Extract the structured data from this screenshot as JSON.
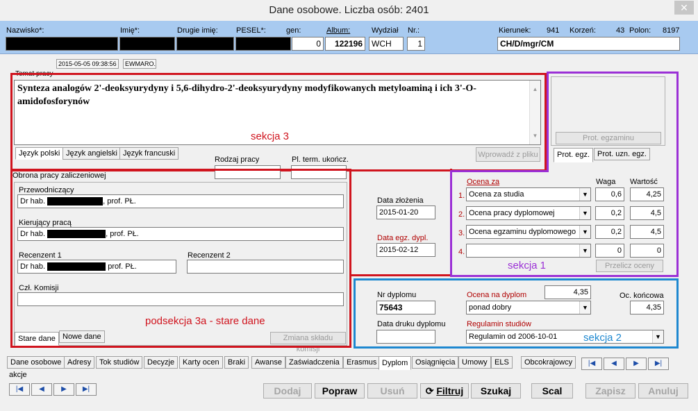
{
  "window": {
    "title": "Dane osobowe. Liczba osób: 2401",
    "close": "✕"
  },
  "header": {
    "labels": {
      "nazwisko": "Nazwisko*:",
      "imie": "Imię*:",
      "drugie_imie": "Drugie imię:",
      "pesel": "PESEL*:",
      "gen": "gen:",
      "album": "Album:",
      "wydzial": "Wydział",
      "nr": "Nr.:",
      "kierunek": "Kierunek:",
      "korzen": "Korzeń:",
      "polon": "Polon:"
    },
    "values": {
      "gen": "0",
      "album": "122196",
      "wydzial": "WCH",
      "nr": "1",
      "kierunek": "941",
      "korzen": "43",
      "polon": "8197",
      "path": "CH/D/mgr/CM"
    }
  },
  "meta": {
    "timestamp": "2015-05-05 09:38:56",
    "user": "EWMARO."
  },
  "thesis": {
    "label": "Temat pracy",
    "title": "Synteza analogów 2'-deoksyurydyny i 5,6-dihydro-2'-deoksyurydyny modyfikowanych metyloaminą i ich 3'-O-amidofosforynów",
    "tabs": [
      "Język polski",
      "Język angielski",
      "Język francuski"
    ],
    "import_button": "Wprowadź z pliku",
    "rodzaj_pracy": "Rodzaj pracy",
    "pl_term": "Pl. term. ukończ."
  },
  "defense": {
    "label": "Obrona pracy zaliczeniowej",
    "przewodniczacy_label": "Przewodniczący",
    "przewodniczacy_prefix": "Dr hab.",
    "przewodniczacy_suffix": ", prof. PŁ.",
    "kierujacy_label": "Kierujący pracą",
    "kierujacy_prefix": "Dr hab.",
    "kierujacy_suffix": ", prof. PŁ.",
    "recenzent1_label": "Recenzent 1",
    "recenzent1_prefix": "Dr hab.",
    "recenzent1_suffix": " prof. PŁ.",
    "recenzent2_label": "Recenzent 2",
    "komisja_label": "Czł. Komisji",
    "tabs": [
      "Stare dane",
      "Nowe dane"
    ],
    "change_button": "Zmiana składu komisji"
  },
  "dates": {
    "zlozenia_label": "Data złożenia",
    "zlozenia": "2015-01-20",
    "egz_label": "Data egz. dypl.",
    "egz": "2015-02-12"
  },
  "prot": {
    "button": "Prot. egzaminu",
    "tabs": [
      "Prot. egz.",
      "Prot. uzn. egz."
    ]
  },
  "grades": {
    "ocena_za": "Ocena za",
    "waga": "Waga",
    "wartosc": "Wartość",
    "rows": [
      {
        "num": "1.",
        "name": "Ocena za studia",
        "waga": "0,6",
        "wartosc": "4,25"
      },
      {
        "num": "2.",
        "name": "Ocena pracy dyplomowej",
        "waga": "0,2",
        "wartosc": "4,5"
      },
      {
        "num": "3.",
        "name": "Ocena egzaminu dyplomowego",
        "waga": "0,2",
        "wartosc": "4,5"
      },
      {
        "num": "4.",
        "name": "",
        "waga": "0",
        "wartosc": "0"
      }
    ],
    "recalc": "Przelicz oceny"
  },
  "diploma": {
    "nr_label": "Nr dyplomu",
    "nr": "75643",
    "ocena_label": "Ocena na dyplom",
    "ocena_num": "4,35",
    "ocena_text": "ponad dobry",
    "koncowa_label": "Oc. końcowa",
    "koncowa": "4,35",
    "druk_label": "Data druku dyplomu",
    "regulamin_label": "Regulamin studiów",
    "regulamin": "Regulamin od 2006-10-01"
  },
  "annotations": {
    "sekcja3": "sekcja 3",
    "sekcja1": "sekcja 1",
    "sekcja2": "sekcja 2",
    "podsekcja": "podsekcja 3a - stare dane"
  },
  "main_tabs": [
    "Dane osobowe",
    "Adresy",
    "Tok studiów",
    "Decyzje",
    "Karty ocen",
    "Braki",
    "Awanse",
    "Zaświadczenia",
    "Erasmus",
    "Dyplom",
    "Osiągnięcia",
    "Umowy",
    "ELS",
    "Obcokrajowcy"
  ],
  "akcje": "akcje",
  "nav": {
    "first": "|◀",
    "prev": "◀",
    "next": "▶",
    "last": "▶|"
  },
  "actions": {
    "dodaj": "Dodaj",
    "popraw": "Popraw",
    "usun": "Usuń",
    "filtruj": "Filtruj",
    "filtruj_icon": "⟳",
    "szukaj": "Szukaj",
    "scal": "Scal",
    "zapisz": "Zapisz",
    "anuluj": "Anuluj"
  },
  "colors": {
    "header_bg": "#a8caf0",
    "red_frame": "#d0141e",
    "purple_frame": "#9b30d6",
    "blue_frame": "#1e88d0"
  }
}
